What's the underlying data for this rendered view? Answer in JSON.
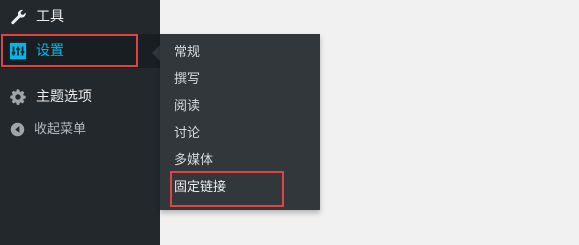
{
  "sidebar": {
    "items": [
      {
        "label": "工具",
        "icon": "wrench-icon"
      },
      {
        "label": "设置",
        "icon": "settings-sliders-icon",
        "active": true
      },
      {
        "label": "主题选项",
        "icon": "gear-icon"
      },
      {
        "label": "收起菜单",
        "icon": "collapse-arrow-icon"
      }
    ]
  },
  "submenu": {
    "items": [
      {
        "label": "常规"
      },
      {
        "label": "撰写"
      },
      {
        "label": "阅读"
      },
      {
        "label": "讨论"
      },
      {
        "label": "多媒体"
      },
      {
        "label": "固定链接"
      }
    ]
  },
  "colors": {
    "sidebar_bg": "#23282d",
    "submenu_bg": "#32373c",
    "active_text": "#00b9eb",
    "highlight_border": "#e04343",
    "page_bg": "#f1f1f1"
  }
}
